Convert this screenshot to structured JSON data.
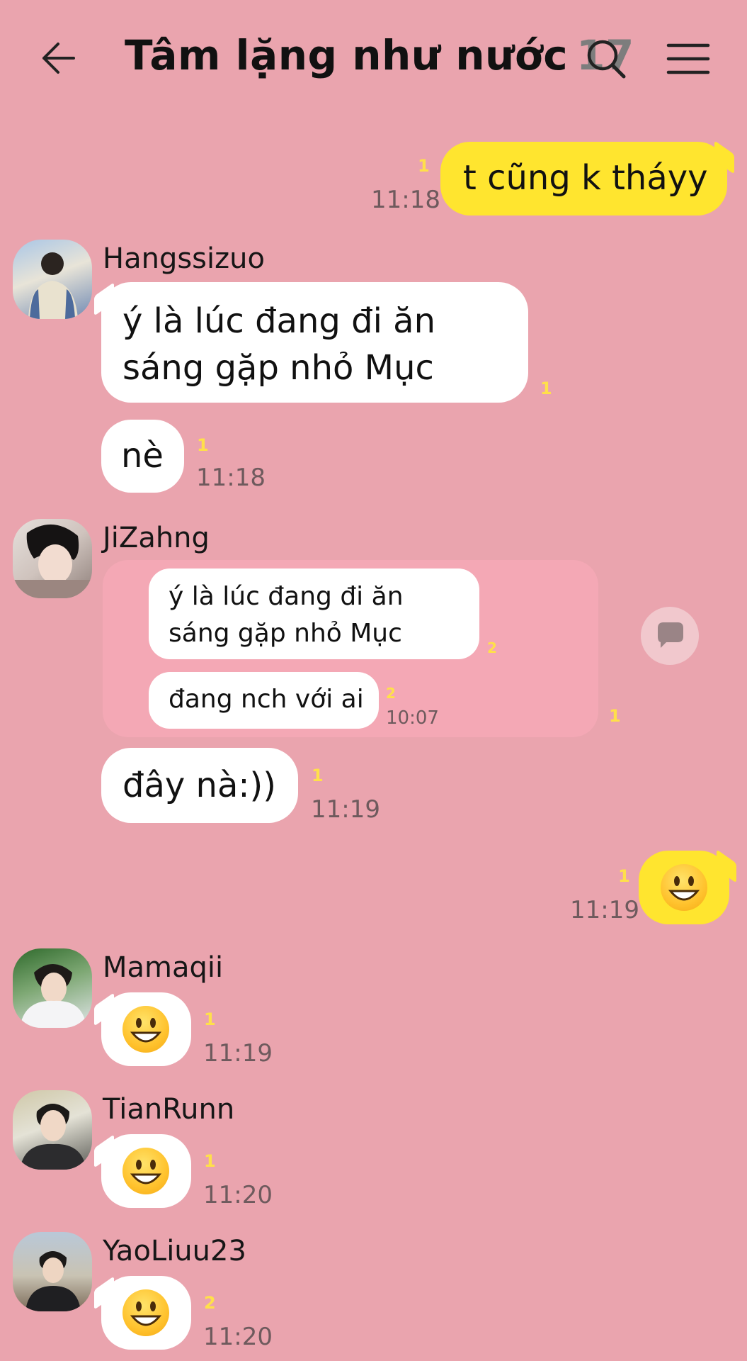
{
  "header": {
    "title": "Tâm lặng như nước",
    "member_count": "17",
    "back_icon": "arrow-left-icon",
    "search_icon": "search-icon",
    "menu_icon": "hamburger-menu-icon"
  },
  "colors": {
    "background": "#eaa4ae",
    "my_bubble": "#ffe52f",
    "other_bubble": "#ffffff",
    "reply_box": "#f4a8b5",
    "unread": "#ffe04a"
  },
  "messages": {
    "m1": {
      "text": "t cũng k tháyy",
      "time": "11:18",
      "unread": "1"
    },
    "m2": {
      "sender": "Hangssizuo",
      "line1": "ý là lúc đang đi ăn",
      "line2": "sáng gặp nhỏ Mục",
      "unread": "1"
    },
    "m3": {
      "text": "nè",
      "unread": "1",
      "time": "11:18"
    },
    "m4": {
      "sender": "JiZahng",
      "quote_line1": "ý là lúc đang đi ăn",
      "quote_line2": "sáng gặp nhỏ Mục",
      "quote_unread": "2",
      "quote2_text": "đang nch với ai",
      "quote2_unread": "2",
      "quote2_time": "10:07",
      "box_unread": "1"
    },
    "m5": {
      "text": "đây nà:))",
      "unread": "1",
      "time": "11:19"
    },
    "m6": {
      "emoji": "smiley-emoji",
      "unread": "1",
      "time": "11:19"
    },
    "m7": {
      "sender": "Mamaqii",
      "emoji": "smiley-emoji",
      "unread": "1",
      "time": "11:19"
    },
    "m8": {
      "sender": "TianRunn",
      "emoji": "smiley-emoji",
      "unread": "1",
      "time": "11:20"
    },
    "m9": {
      "sender": "YaoLiuu23",
      "emoji": "smiley-emoji",
      "unread": "2",
      "time": "11:20"
    }
  }
}
